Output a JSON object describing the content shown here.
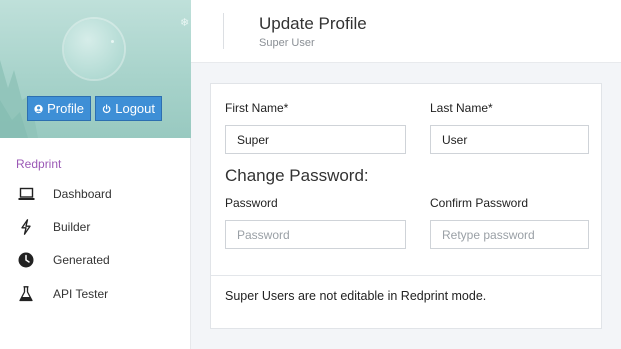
{
  "sidebar": {
    "profile_button": "Profile",
    "logout_button": "Logout",
    "brand": "Redprint",
    "items": [
      {
        "label": "Dashboard",
        "icon": "laptop-icon"
      },
      {
        "label": "Builder",
        "icon": "bolt-icon"
      },
      {
        "label": "Generated",
        "icon": "clock-icon"
      },
      {
        "label": "API Tester",
        "icon": "flask-icon"
      }
    ]
  },
  "header": {
    "title": "Update Profile",
    "subtitle": "Super User"
  },
  "form": {
    "first_name_label": "First Name*",
    "first_name_value": "Super",
    "last_name_label": "Last Name*",
    "last_name_value": "User",
    "section_title": "Change Password:",
    "password_label": "Password",
    "password_placeholder": "Password",
    "confirm_label": "Confirm Password",
    "confirm_placeholder": "Retype password",
    "notice": "Super Users are not editable in Redprint mode."
  },
  "colors": {
    "accent": "#3e8fd6",
    "brand": "#9b59b6",
    "sidebar_header": "#a8d3cb"
  }
}
